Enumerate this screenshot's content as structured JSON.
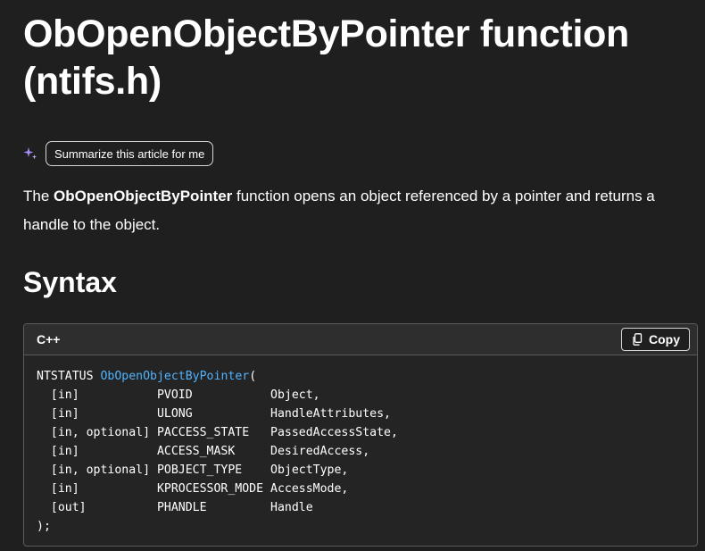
{
  "article": {
    "title": "ObOpenObjectByPointer function (ntifs.h)",
    "summarize_label": "Summarize this article for me",
    "sparkle_icon": "sparkle-icon",
    "description": {
      "prefix": "The ",
      "bold": "ObOpenObjectByPointer",
      "suffix": " function opens an object referenced by a pointer and returns a handle to the object."
    },
    "syntax_heading": "Syntax"
  },
  "code_block": {
    "language": "C++",
    "copy_label": "Copy",
    "copy_icon": "copy-icon",
    "first_line": {
      "return_type": "NTSTATUS ",
      "function_name": "ObOpenObjectByPointer",
      "open_paren": "("
    },
    "params": [
      "  [in]           PVOID           Object,",
      "  [in]           ULONG           HandleAttributes,",
      "  [in, optional] PACCESS_STATE   PassedAccessState,",
      "  [in]           ACCESS_MASK     DesiredAccess,",
      "  [in, optional] POBJECT_TYPE    ObjectType,",
      "  [in]           KPROCESSOR_MODE AccessMode,",
      "  [out]          PHANDLE         Handle"
    ],
    "last_line": ");"
  },
  "colors": {
    "background": "#1f1f1f",
    "code_background": "#242424",
    "code_header": "#2e2e2e",
    "function_name": "#4fb3ff",
    "sparkle": "#a78bfa"
  }
}
